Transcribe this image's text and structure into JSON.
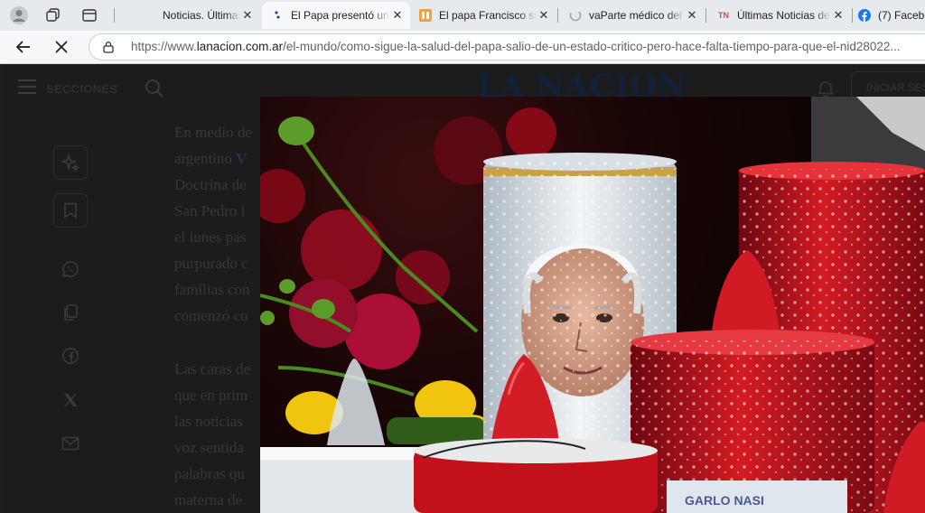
{
  "browser": {
    "tabs": [
      {
        "title": "Noticias. Últimas noticias de",
        "favicon": "la-nacion-icon",
        "active": false
      },
      {
        "title": "El Papa presentó una",
        "favicon": "la-nacion-icon",
        "active": true
      },
      {
        "title": "El papa Francisco sufrió",
        "favicon": "news-icon",
        "active": false
      },
      {
        "title": "vaParte médico del papa",
        "favicon": "loading-icon",
        "active": false
      },
      {
        "title": "Últimas Noticias de",
        "favicon": "tn-icon",
        "active": false
      },
      {
        "title": "(7) Facebook",
        "favicon": "facebook-icon",
        "active": false
      }
    ],
    "url_prefix": "https://www.",
    "url_domain": "lanacion.com.ar",
    "url_path": "/el-mundo/como-sigue-la-salud-del-papa-salio-de-un-estado-critico-pero-hace-falta-tiempo-para-que-el-nid28022..."
  },
  "site": {
    "sections_label": "SECCIONES",
    "logo_text": "LA NACION",
    "login_label": "INICIAR SESIÓN"
  },
  "article": {
    "para1": [
      {
        "text": "En medio de"
      },
      {
        "text": "argentino ",
        "link": "V"
      },
      {
        "text": "Doctrina de"
      },
      {
        "text": "San Pedro l"
      },
      {
        "text": "el lunes pas"
      },
      {
        "text": "purpurado c"
      },
      {
        "text": "familias con"
      },
      {
        "text": "comenzó co"
      }
    ],
    "para2": [
      {
        "text": "Las caras de"
      },
      {
        "text": "que en prim"
      },
      {
        "text": "las noticias"
      },
      {
        "text": "voz sentida"
      },
      {
        "text": "palabras qu"
      },
      {
        "text": "materna de"
      }
    ]
  },
  "icons": {
    "side": [
      "sparkle-icon",
      "bookmark-icon"
    ],
    "share": [
      "whatsapp-icon",
      "copy-icon",
      "facebook-icon",
      "x-icon",
      "mail-icon"
    ]
  },
  "photo": {
    "label_text": "GARLO NASI",
    "colors": {
      "candle_red": "#c8101a",
      "leaf_green": "#4a8a1e",
      "flower_yellow": "#f1c40f",
      "glass_white": "#e8eef2"
    }
  }
}
